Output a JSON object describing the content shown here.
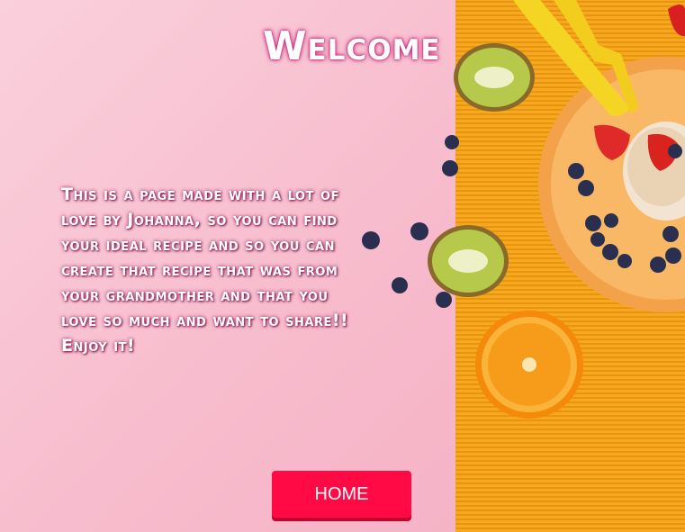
{
  "header": {
    "title": "Welcome"
  },
  "main": {
    "description": "This is a page made with a lot of love by Johanna, so you can find your ideal recipe and so you can create that recipe that was from your grandmother and that you love so much and want to share!! Enjoy it!"
  },
  "nav": {
    "home_label": "HOME"
  },
  "colors": {
    "background_pink": "#f7bccd",
    "background_orange": "#f6a91e",
    "button": "#ff0a45",
    "text": "#ffffff"
  }
}
